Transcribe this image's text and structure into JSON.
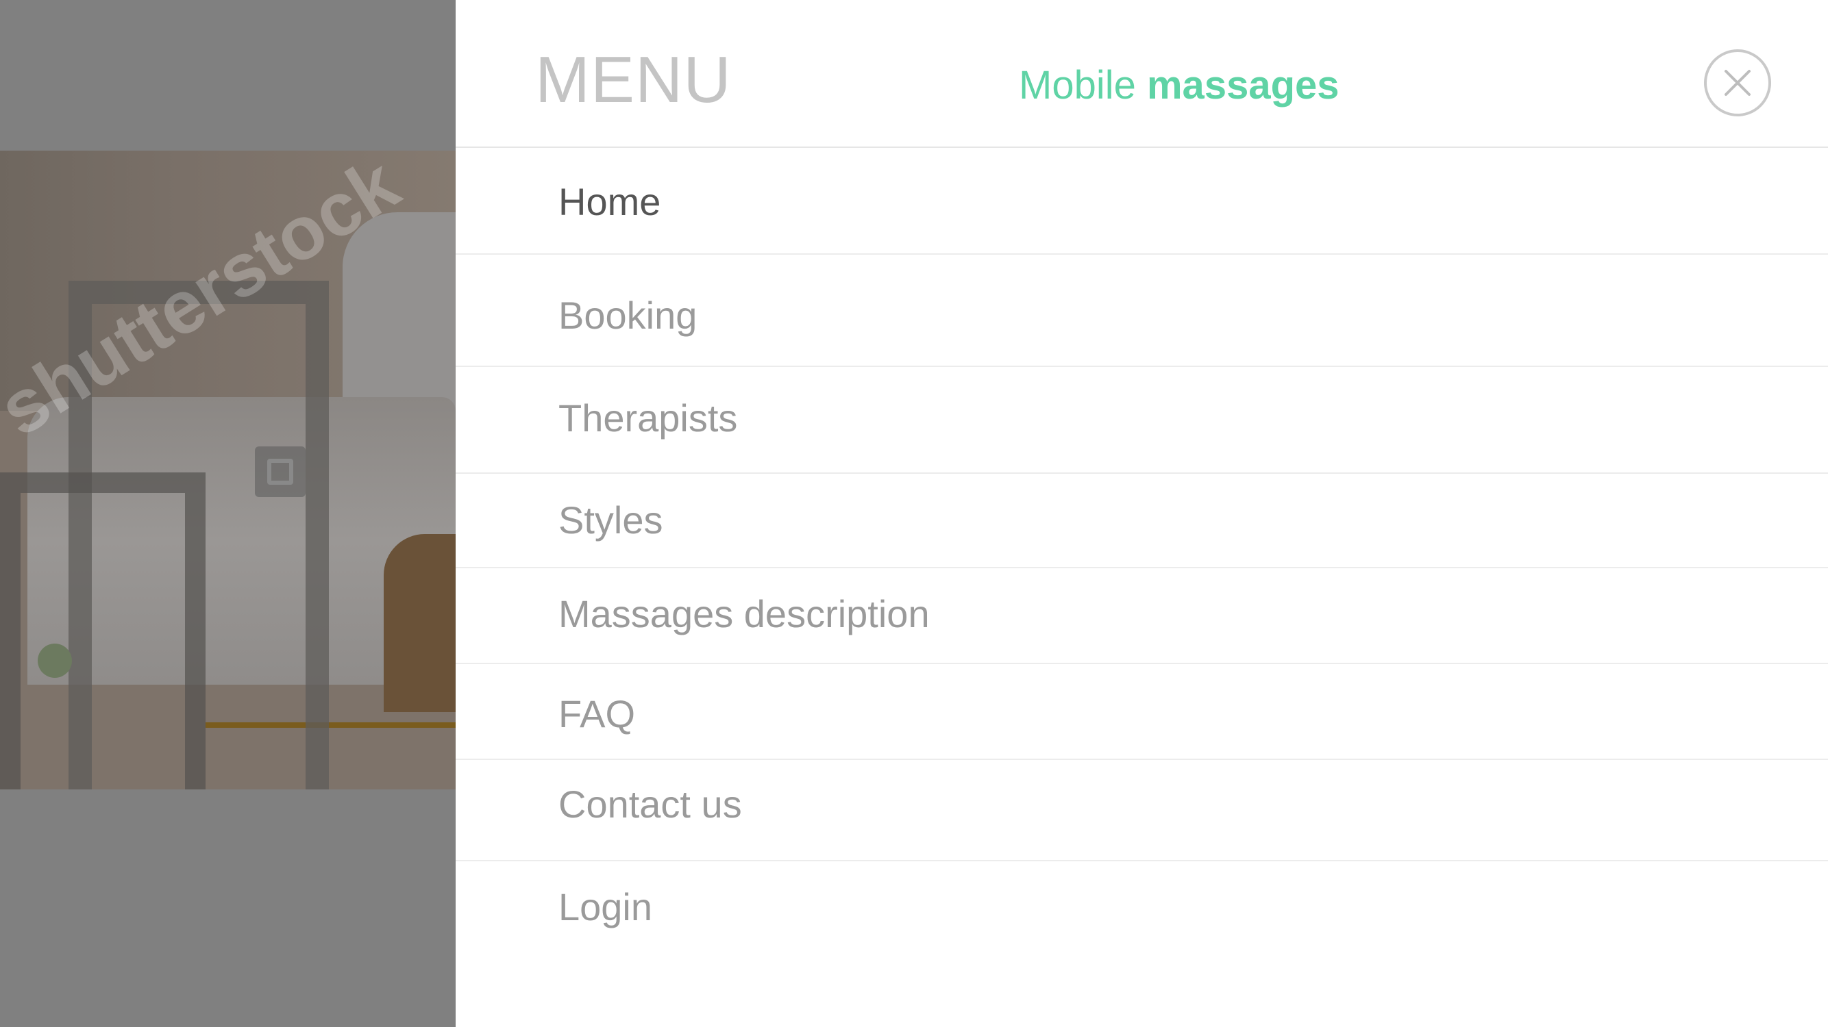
{
  "header": {
    "menu_title": "MENU",
    "brand_light": "Mobile",
    "brand_bold": "massages",
    "close_icon": "close-icon"
  },
  "colors": {
    "accent": "#5fd3a5",
    "active_text": "#555555",
    "item_text": "#9a9a9a",
    "menu_title": "#c4c4c4"
  },
  "background": {
    "watermark_text": "shutterstock"
  },
  "menu": {
    "items": [
      {
        "label": "Home",
        "active": true
      },
      {
        "label": "Booking",
        "active": false
      },
      {
        "label": "Therapists",
        "active": false
      },
      {
        "label": "Styles",
        "active": false
      },
      {
        "label": "Massages description",
        "active": false
      },
      {
        "label": "FAQ",
        "active": false
      },
      {
        "label": "Contact us",
        "active": false
      },
      {
        "label": "Login",
        "active": false
      }
    ]
  }
}
